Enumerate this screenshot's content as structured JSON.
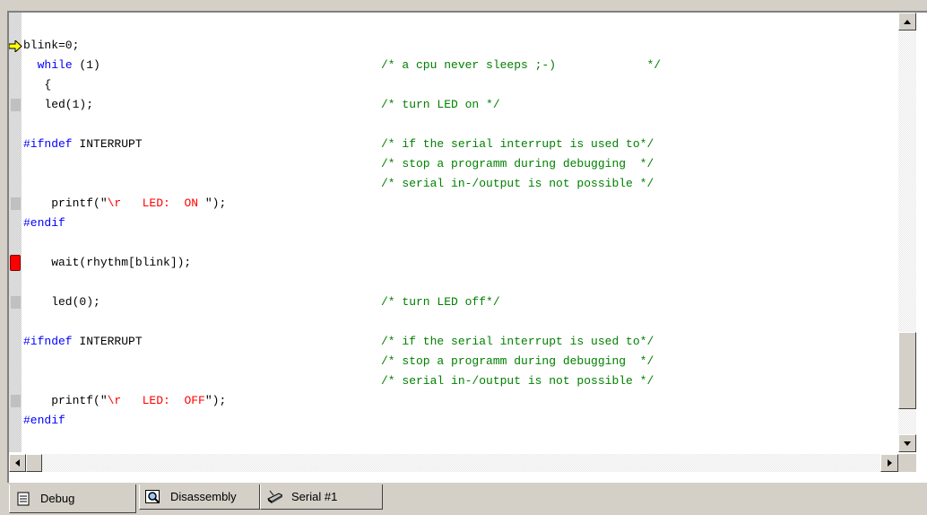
{
  "editor": {
    "lines": [
      {
        "marker": "arrow",
        "code": "blink=0;",
        "comment": ""
      },
      {
        "marker": "",
        "code": "  <kw>while</kw> (1)",
        "comment": "/* a cpu never sleeps ;-)             */"
      },
      {
        "marker": "",
        "code": "   {",
        "comment": ""
      },
      {
        "marker": "block",
        "code": "   led(1);",
        "comment": "/* turn LED on */"
      },
      {
        "marker": "",
        "code": "",
        "comment": ""
      },
      {
        "marker": "",
        "code": "<kw>#ifndef</kw> INTERRUPT",
        "comment": "/* if the serial interrupt is used to*/"
      },
      {
        "marker": "",
        "code": "",
        "comment": "/* stop a programm during debugging  */"
      },
      {
        "marker": "",
        "code": "",
        "comment": "/* serial in-/output is not possible */"
      },
      {
        "marker": "block",
        "code": "    printf(\"<str>\\r   LED:  ON </str>\");",
        "comment": ""
      },
      {
        "marker": "",
        "code": "<kw>#endif</kw>",
        "comment": ""
      },
      {
        "marker": "",
        "code": "",
        "comment": ""
      },
      {
        "marker": "breakpoint",
        "code": "    wait(rhythm[blink]);",
        "comment": ""
      },
      {
        "marker": "",
        "code": "",
        "comment": ""
      },
      {
        "marker": "block",
        "code": "    led(0);",
        "comment": "/* turn LED off*/"
      },
      {
        "marker": "",
        "code": "",
        "comment": ""
      },
      {
        "marker": "",
        "code": "<kw>#ifndef</kw> INTERRUPT",
        "comment": "/* if the serial interrupt is used to*/"
      },
      {
        "marker": "",
        "code": "",
        "comment": "/* stop a programm during debugging  */"
      },
      {
        "marker": "",
        "code": "",
        "comment": "/* serial in-/output is not possible */"
      },
      {
        "marker": "block",
        "code": "    printf(\"<str>\\r   LED:  OFF</str>\");",
        "comment": ""
      },
      {
        "marker": "",
        "code": "<kw>#endif</kw>",
        "comment": ""
      }
    ],
    "colors": {
      "keyword": "#0000ff",
      "comment": "#008000",
      "string": "#ff0000",
      "breakpoint": "#ff0000",
      "arrow": "#ffff00"
    }
  },
  "tabs": [
    {
      "label": "Debug",
      "icon": "document-icon",
      "active": true
    },
    {
      "label": "Disassembly",
      "icon": "magnifier-icon",
      "active": false
    },
    {
      "label": "Serial #1",
      "icon": "serial-port-icon",
      "active": false
    }
  ]
}
